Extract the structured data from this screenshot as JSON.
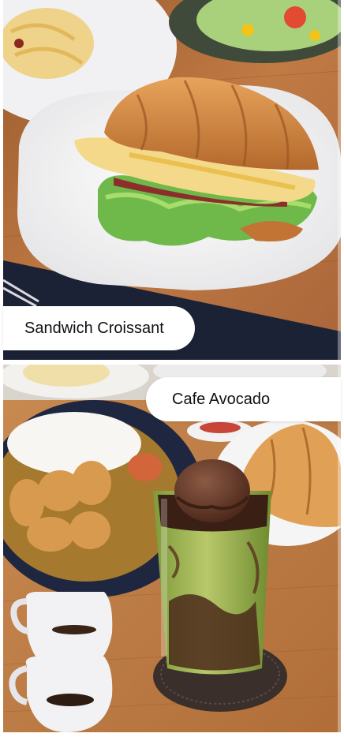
{
  "cards": [
    {
      "caption": "Sandwich Croissant",
      "image": "sandwich-croissant-photo"
    },
    {
      "caption": "Cafe Avocado",
      "image": "cafe-avocado-photo"
    }
  ],
  "colors": {
    "caption_bg": "#ffffff",
    "caption_text": "#111111",
    "table_wood": "#b9733f",
    "placemat": "#1c2236",
    "avocado_green": "#9bb04e"
  }
}
